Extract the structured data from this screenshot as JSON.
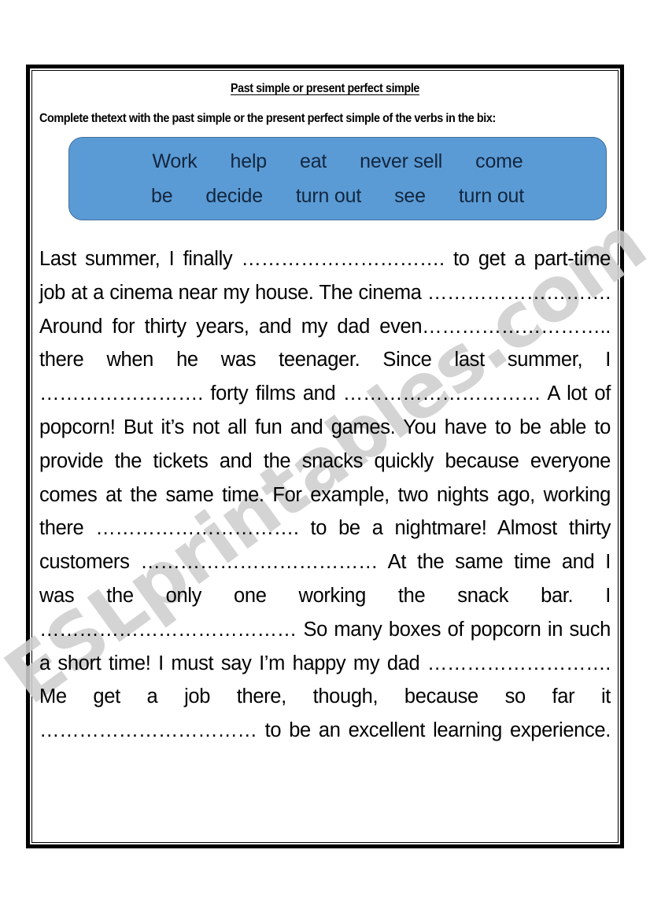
{
  "page": {
    "background": "#ffffff",
    "border_color": "#000000"
  },
  "watermark": {
    "text": "ESLprintables.com",
    "color": "#cfcfcf",
    "rotation_deg": -36
  },
  "header": {
    "title": "Past simple or present perfect simple",
    "instruction": "Complete thetext with the past simple or the present perfect simple of the verbs in the bix:"
  },
  "word_bank": {
    "background_color": "#5B9BD5",
    "border_color": "#41719C",
    "text_color": "#12263F",
    "rows": [
      {
        "words": [
          "Work",
          "help",
          "eat",
          "never sell",
          "come"
        ]
      },
      {
        "words": [
          "be",
          "decide",
          "turn out",
          "see",
          "turn out"
        ]
      }
    ]
  },
  "exercise": {
    "paragraph": "Last summer, I finally …………………………. to get a part-time job at a cinema near my house. The cinema ………………………. Around for thirty years, and my dad even……………………….. there when he was teenager. Since last summer, I ……………………. forty films and ………………………… A lot of popcorn! But it’s not all fun and games. You have to be able to provide the tickets and the snacks quickly because everyone comes at the same time. For example, two nights ago, working there …………………………. to be a nightmare! Almost thirty customers ……………………………… At the same time and I was the only one working the snack bar. I ………………………………… So many boxes of popcorn in such a short time! I must say I’m happy my dad ………………………. Me get a job there, though, because so far it …………………………… to be an excellent learning experience."
  }
}
